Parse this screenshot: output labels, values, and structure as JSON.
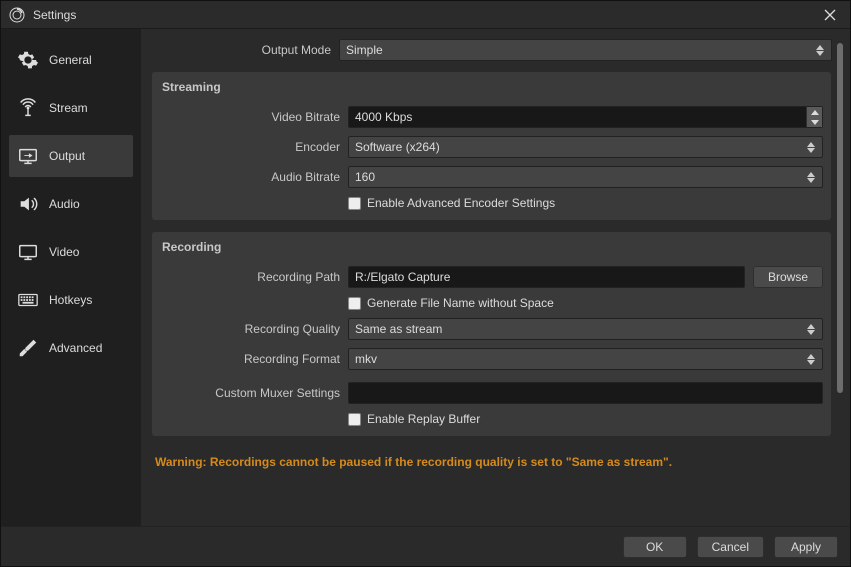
{
  "title": "Settings",
  "sidebar": {
    "items": [
      {
        "label": "General"
      },
      {
        "label": "Stream"
      },
      {
        "label": "Output"
      },
      {
        "label": "Audio"
      },
      {
        "label": "Video"
      },
      {
        "label": "Hotkeys"
      },
      {
        "label": "Advanced"
      }
    ],
    "active_index": 2
  },
  "output_mode": {
    "label": "Output Mode",
    "value": "Simple"
  },
  "streaming": {
    "heading": "Streaming",
    "video_bitrate_label": "Video Bitrate",
    "video_bitrate_value": "4000 Kbps",
    "encoder_label": "Encoder",
    "encoder_value": "Software (x264)",
    "audio_bitrate_label": "Audio Bitrate",
    "audio_bitrate_value": "160",
    "enable_advanced_label": "Enable Advanced Encoder Settings",
    "enable_advanced_checked": false
  },
  "recording": {
    "heading": "Recording",
    "path_label": "Recording Path",
    "path_value": "R:/Elgato Capture",
    "browse_label": "Browse",
    "gen_filename_label": "Generate File Name without Space",
    "gen_filename_checked": false,
    "quality_label": "Recording Quality",
    "quality_value": "Same as stream",
    "format_label": "Recording Format",
    "format_value": "mkv",
    "muxer_label": "Custom Muxer Settings",
    "muxer_value": "",
    "replay_buffer_label": "Enable Replay Buffer",
    "replay_buffer_checked": false
  },
  "warning": "Warning: Recordings cannot be paused if the recording quality is set to \"Same as stream\".",
  "buttons": {
    "ok": "OK",
    "cancel": "Cancel",
    "apply": "Apply"
  }
}
